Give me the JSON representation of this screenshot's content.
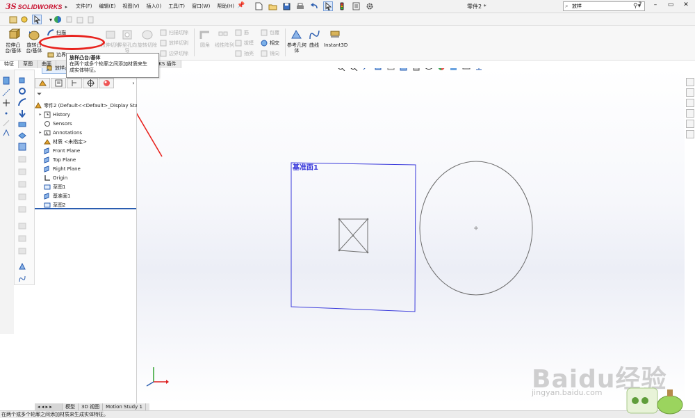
{
  "app": {
    "logo_ds": "3S",
    "logo_text": "SOLIDWORKS",
    "document_title": "零件2 *",
    "menu": [
      "文件(F)",
      "编辑(E)",
      "视图(V)",
      "插入(I)",
      "工具(T)",
      "窗口(W)",
      "帮助(H)"
    ],
    "search_value": "放样",
    "window_controls": [
      "?",
      "–",
      "▭",
      "✕"
    ]
  },
  "commands": {
    "extrude_boss": "拉伸凸台/基体",
    "revolve_boss": "旋转凸台/基体",
    "sweep": "扫描",
    "loft_boss": "放样凸台/基体",
    "boundary_boss": "边界",
    "extrude_cut": "拉伸切除",
    "hole_wizard": "异型孔向导",
    "revolve_cut": "旋转切除",
    "sweep_cut": "扫描切除",
    "loft_cut": "放样切割",
    "boundary_cut": "边界切除",
    "fillet": "圆角",
    "linear_pattern": "线性阵列",
    "rib": "筋",
    "draft": "拔模",
    "shell": "抽壳",
    "wrap": "包覆",
    "intersect": "相交",
    "mirror": "镜向",
    "reference_geometry": "参考几何体",
    "curves": "曲线",
    "instant3d": "Instant3D"
  },
  "tabs": [
    "特征",
    "草图",
    "曲面",
    "WORKS 插件"
  ],
  "tooltip": {
    "title": "放样凸台/基体",
    "description_line1": "在两个或多个轮廓之间添加材质来生",
    "description_line2": "成实体特征。"
  },
  "tree": {
    "root": "零件2  (Default<<Default>_Display Sta",
    "items": [
      {
        "label": "History",
        "icon": "history-icon",
        "expandable": true
      },
      {
        "label": "Sensors",
        "icon": "sensor-icon",
        "expandable": false
      },
      {
        "label": "Annotations",
        "icon": "annotation-icon",
        "expandable": true
      },
      {
        "label": "材质 <未指定>",
        "icon": "material-icon",
        "expandable": false
      },
      {
        "label": "Front Plane",
        "icon": "plane-icon",
        "expandable": false
      },
      {
        "label": "Top Plane",
        "icon": "plane-icon",
        "expandable": false
      },
      {
        "label": "Right Plane",
        "icon": "plane-icon",
        "expandable": false
      },
      {
        "label": "Origin",
        "icon": "origin-icon",
        "expandable": false
      },
      {
        "label": "草图1",
        "icon": "sketch-icon",
        "expandable": false
      },
      {
        "label": "基准面1",
        "icon": "plane-icon",
        "expandable": false
      },
      {
        "label": "草图2",
        "icon": "sketch-icon",
        "expandable": false
      }
    ]
  },
  "bottom_tabs": [
    "模型",
    "3D 视图",
    "Motion Study 1"
  ],
  "viewport": {
    "plane_label": "基准面1"
  },
  "status_text": "在两个或多个轮廓之间添加材质来生成实体特征。",
  "watermark": {
    "text": "Baidu经验",
    "url": "jingyan.baidu.com"
  },
  "colors": {
    "accent_red": "#e8231e",
    "plane_blue": "#3b3bdb",
    "brand_red": "#c8102e"
  }
}
